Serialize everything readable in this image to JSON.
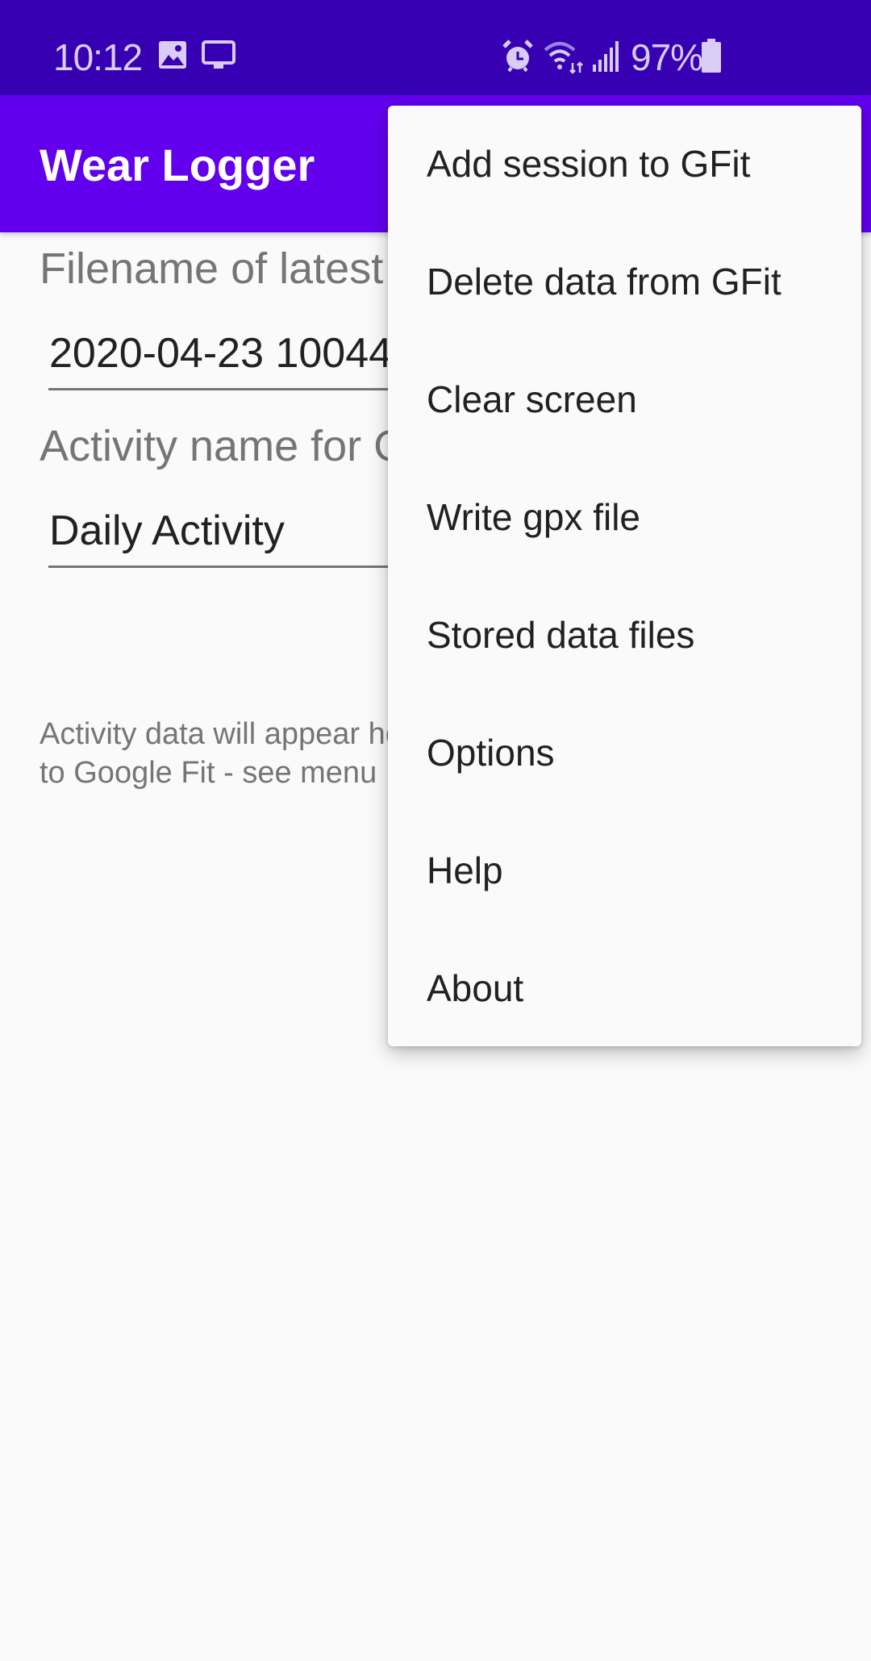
{
  "status_bar": {
    "time": "10:12",
    "left_icons": [
      "gallery-icon",
      "cast-screen-icon"
    ],
    "right_icons": [
      "alarm-icon",
      "wifi-icon",
      "signal-icon",
      "battery-icon"
    ],
    "battery_percent": "97%",
    "background_color": "#3700b3"
  },
  "app_bar": {
    "title": "Wear Logger",
    "background_color": "#6200ee"
  },
  "main": {
    "filename_label": "Filename of latest data",
    "filename_value": "2020-04-23 10044",
    "activity_label": "Activity name for GFit",
    "activity_value": "Daily Activity",
    "info_line1": "Activity data will appear here once uploaded",
    "info_line2": "to Google Fit - see menu"
  },
  "overflow_menu": {
    "items": [
      {
        "label": "Add session to GFit"
      },
      {
        "label": "Delete data from GFit"
      },
      {
        "label": "Clear screen"
      },
      {
        "label": "Write gpx file"
      },
      {
        "label": "Stored data files"
      },
      {
        "label": "Options"
      },
      {
        "label": "Help"
      },
      {
        "label": "About"
      }
    ]
  }
}
